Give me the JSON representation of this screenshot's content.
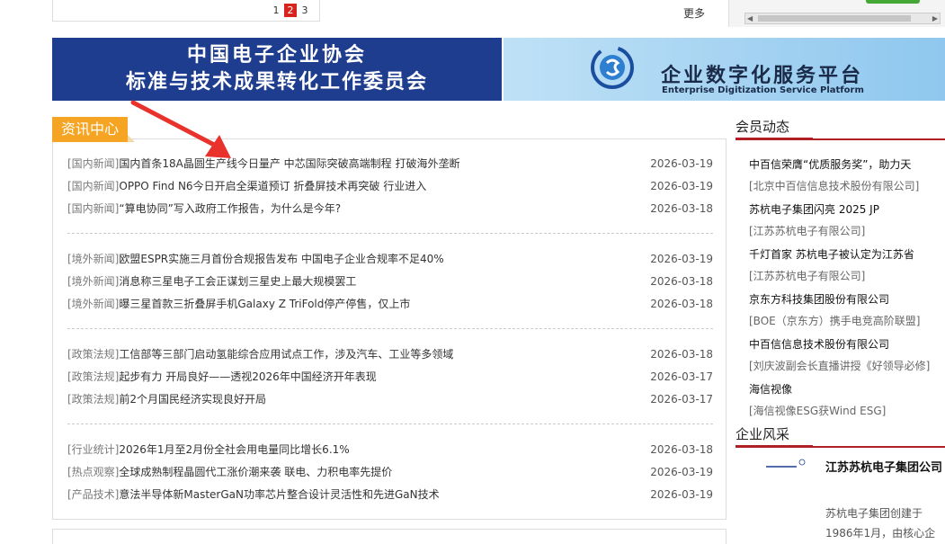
{
  "top": {
    "pages": [
      "1",
      "2",
      "3"
    ],
    "current_page": "2",
    "more": "更多"
  },
  "banners": {
    "left_line1": "中国电子企业协会",
    "left_line2": "标准与技术成果转化工作委员会",
    "right_cn": "企业数字化服务平台",
    "right_en": "Enterprise Digitization Service Platform"
  },
  "news": {
    "tab_label": "资讯中心",
    "items": [
      {
        "cat": "[国内新闻]",
        "title": "国内首条18A晶圆生产线今日量产 中芯国际突破高端制程 打破海外垄断",
        "date": "2026-03-19"
      },
      {
        "cat": "[国内新闻]",
        "title": "OPPO Find N6今日开启全渠道预订 折叠屏技术再突破 行业进入",
        "date": "2026-03-19"
      },
      {
        "cat": "[国内新闻]",
        "title": "“算电协同”写入政府工作报告，为什么是今年?",
        "date": "2026-03-18"
      },
      {
        "cat": "[境外新闻]",
        "title": "欧盟ESPR实施三月首份合规报告发布 中国电子企业合规率不足40%",
        "date": "2026-03-19"
      },
      {
        "cat": "[境外新闻]",
        "title": "消息称三星电子工会正谋划三星史上最大规模罢工",
        "date": "2026-03-18"
      },
      {
        "cat": "[境外新闻]",
        "title": "曝三星首款三折叠屏手机Galaxy Z TriFold停产停售，仅上市",
        "date": "2026-03-18"
      },
      {
        "cat": "[政策法规]",
        "title": "工信部等三部门启动氢能综合应用试点工作，涉及汽车、工业等多领域",
        "date": "2026-03-18"
      },
      {
        "cat": "[政策法规]",
        "title": "起步有力 开局良好——透视2026年中国经济开年表现",
        "date": "2026-03-17"
      },
      {
        "cat": "[政策法规]",
        "title": "前2个月国民经济实现良好开局",
        "date": "2026-03-17"
      },
      {
        "cat": "[行业统计]",
        "title": "2026年1月至2月份全社会用电量同比增长6.1%",
        "date": "2026-03-18"
      },
      {
        "cat": "[热点观察]",
        "title": "全球成熟制程晶圆代工涨价潮来袭 联电、力积电率先提价",
        "date": "2026-03-19"
      },
      {
        "cat": "[产品技术]",
        "title": "意法半导体新MasterGaN功率芯片整合设计灵活性和先进GaN技术",
        "date": "2026-03-19"
      }
    ]
  },
  "members": {
    "heading": "会员动态",
    "items": [
      {
        "title": "中百信荣膺“优质服务奖”，助力天",
        "source": "[北京中百信信息技术股份有限公司]"
      },
      {
        "title": "苏杭电子集团闪亮 2025 JP",
        "source": "[江苏苏杭电子有限公司]"
      },
      {
        "title": "千灯首家 苏杭电子被认定为江苏省",
        "source": "[江苏苏杭电子有限公司]"
      },
      {
        "title": "京东方科技集团股份有限公司",
        "source": "[BOE（京东方）携手电竞高阶联盟]"
      },
      {
        "title": "中百信信息技术股份有限公司",
        "source": "[刘庆波副会长直播讲授《好领导必修]"
      },
      {
        "title": "海信视像",
        "source": "[海信视像ESG获Wind ESG]"
      }
    ]
  },
  "corp": {
    "heading": "企业风采",
    "name": "江苏苏杭电子集团公司",
    "desc": "苏杭电子集团创建于1986年1月，由核心企"
  },
  "colors": {
    "accent_red": "#b01f24",
    "tab_orange": "#f5a523",
    "banner_blue": "#1f3d8f"
  }
}
